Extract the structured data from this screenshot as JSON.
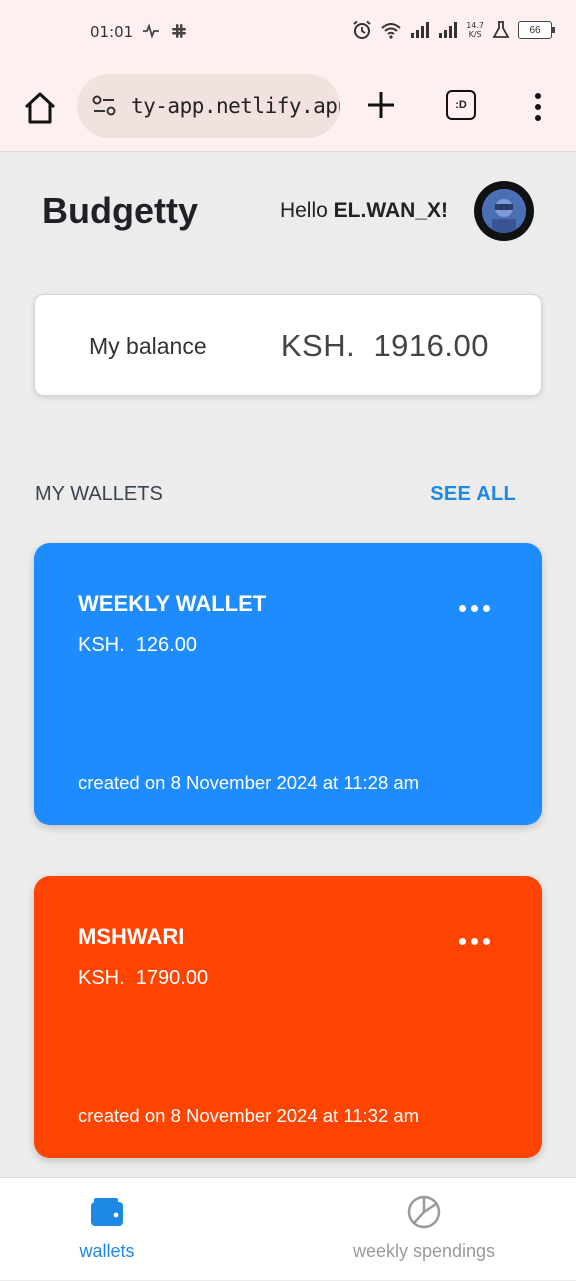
{
  "status_bar": {
    "time": "01:01",
    "net_speed_value": "14.7",
    "net_speed_unit": "K/S",
    "battery": "66"
  },
  "browser": {
    "url": "ty-app.netlify.app",
    "tab_switch_label": ":D"
  },
  "header": {
    "app_title": "Budgetty",
    "greeting_prefix": "Hello",
    "username": "EL.WAN_X!"
  },
  "balance": {
    "label": "My balance",
    "value": "KSH.  1916.00"
  },
  "wallets_section": {
    "heading": "MY WALLETS",
    "see_all": "SEE ALL"
  },
  "wallets": [
    {
      "name": "WEEKLY WALLET",
      "amount": "KSH.  126.00",
      "created": "created on 8 November 2024 at 11:28 am",
      "color": "#1e8cfc"
    },
    {
      "name": "MSHWARI",
      "amount": "KSH.  1790.00",
      "created": "created on 8 November 2024 at 11:32 am",
      "color": "#fe4400"
    }
  ],
  "bottom_nav": {
    "items": [
      {
        "label": "wallets",
        "icon": "wallet-icon",
        "active": true
      },
      {
        "label": "weekly spendings",
        "icon": "pie-chart-icon",
        "active": false
      }
    ]
  },
  "colors": {
    "accent": "#1e88e5",
    "page_bg": "#ececec"
  }
}
